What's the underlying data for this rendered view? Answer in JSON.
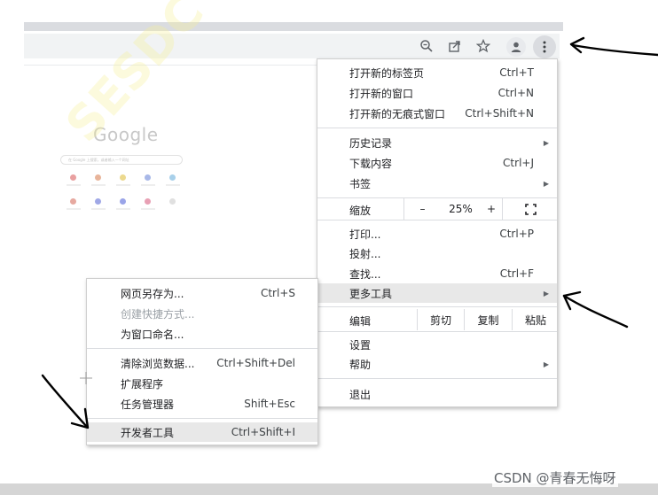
{
  "toolbar": {
    "icons": [
      "zoom-out-icon",
      "share-icon",
      "bookmark-star-icon",
      "profile-icon",
      "kebab-menu-icon"
    ]
  },
  "new_tab_page": {
    "logo": "Google",
    "search_placeholder": "在 Google 上搜索，或者输入一个网址"
  },
  "watermark": "SESDC",
  "main_menu": {
    "new_tab": {
      "label": "打开新的标签页",
      "shortcut": "Ctrl+T"
    },
    "new_window": {
      "label": "打开新的窗口",
      "shortcut": "Ctrl+N"
    },
    "new_incognito": {
      "label": "打开新的无痕式窗口",
      "shortcut": "Ctrl+Shift+N"
    },
    "history": {
      "label": "历史记录"
    },
    "downloads": {
      "label": "下载内容",
      "shortcut": "Ctrl+J"
    },
    "bookmarks": {
      "label": "书签"
    },
    "zoom": {
      "label": "缩放",
      "minus": "–",
      "value": "25%",
      "plus": "+"
    },
    "print": {
      "label": "打印...",
      "shortcut": "Ctrl+P"
    },
    "cast": {
      "label": "投射..."
    },
    "find": {
      "label": "查找...",
      "shortcut": "Ctrl+F"
    },
    "more_tools": {
      "label": "更多工具"
    },
    "edit": {
      "label": "编辑",
      "cut": "剪切",
      "copy": "复制",
      "paste": "粘贴"
    },
    "settings": {
      "label": "设置"
    },
    "help": {
      "label": "帮助"
    },
    "exit": {
      "label": "退出"
    }
  },
  "sub_menu": {
    "save_page": {
      "label": "网页另存为...",
      "shortcut": "Ctrl+S"
    },
    "create_shortcut": {
      "label": "创建快捷方式..."
    },
    "name_window": {
      "label": "为窗口命名..."
    },
    "clear_data": {
      "label": "清除浏览数据...",
      "shortcut": "Ctrl+Shift+Del"
    },
    "extensions": {
      "label": "扩展程序"
    },
    "task_manager": {
      "label": "任务管理器",
      "shortcut": "Shift+Esc"
    },
    "dev_tools": {
      "label": "开发者工具",
      "shortcut": "Ctrl+Shift+I"
    }
  },
  "credit": "CSDN @青春无悔呀",
  "colors": {
    "highlight": "#e8e8e8",
    "toolbar": "#f1f3f4",
    "disabled_text": "#9aa0a6",
    "annotation_ink": "#000000"
  }
}
